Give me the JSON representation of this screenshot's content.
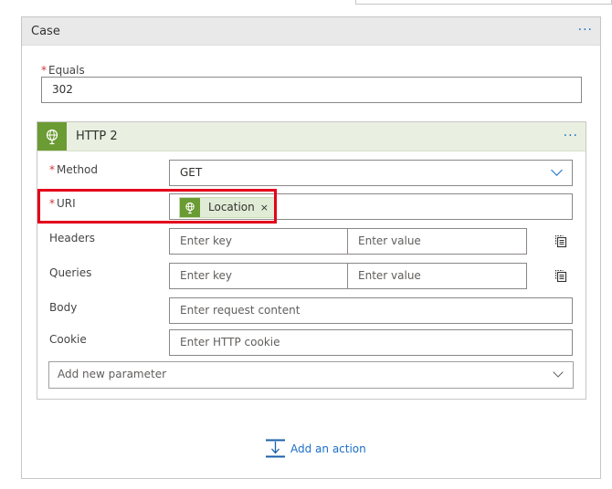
{
  "case": {
    "title": "Case",
    "more_label": "···",
    "equals": {
      "label": "Equals",
      "required_mark": "*",
      "value": "302"
    }
  },
  "http": {
    "title": "HTTP 2",
    "more_label": "···",
    "method": {
      "label": "Method",
      "required_mark": "*",
      "value": "GET"
    },
    "uri": {
      "label": "URI",
      "required_mark": "*",
      "token": "Location",
      "token_close": "×"
    },
    "headers": {
      "label": "Headers",
      "key_placeholder": "Enter key",
      "value_placeholder": "Enter value"
    },
    "queries": {
      "label": "Queries",
      "key_placeholder": "Enter key",
      "value_placeholder": "Enter value"
    },
    "body": {
      "label": "Body",
      "placeholder": "Enter request content"
    },
    "cookie": {
      "label": "Cookie",
      "placeholder": "Enter HTTP cookie"
    },
    "add_parameter": "Add new parameter"
  },
  "add_action": "Add an action",
  "colors": {
    "accent": "#1a6fc7",
    "http_green": "#6b9b33",
    "highlight": "#e3001b",
    "required": "#d13438"
  }
}
